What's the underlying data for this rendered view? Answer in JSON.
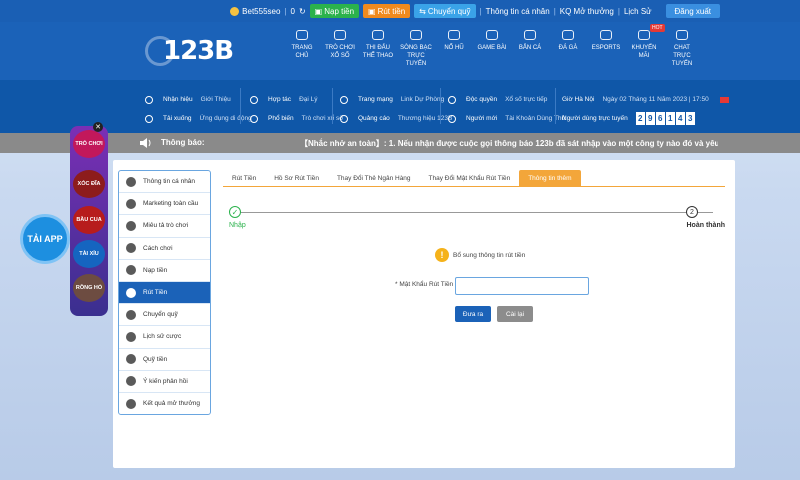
{
  "topbar": {
    "username": "Bet555seo",
    "balance": "0",
    "deposit_label": "Nạp tiền",
    "withdraw_label": "Rút tiền",
    "transfer_label": "Chuyển quỹ",
    "links": [
      "Thông tin cá nhân",
      "KQ Mở thưởng",
      "Lịch Sử"
    ],
    "logout_label": "Đăng xuất"
  },
  "nav": {
    "logo": "123B",
    "menu": [
      {
        "label": "TRANG CHỦ",
        "icon": "home-icon"
      },
      {
        "label": "TRÒ CHƠI XỔ SỐ",
        "icon": "lottery-icon"
      },
      {
        "label": "THI ĐẤU THỂ THAO",
        "icon": "sports-icon"
      },
      {
        "label": "SÒNG BẠC TRỰC TUYẾN",
        "icon": "casino-icon"
      },
      {
        "label": "NỔ HŨ",
        "icon": "slot-icon"
      },
      {
        "label": "GAME BÀI",
        "icon": "cards-icon"
      },
      {
        "label": "BẮN CÁ",
        "icon": "fish-icon"
      },
      {
        "label": "ĐÁ GÀ",
        "icon": "rooster-icon"
      },
      {
        "label": "ESPORTS",
        "icon": "esports-icon"
      },
      {
        "label": "KHUYẾN MÃI",
        "icon": "gift-icon",
        "badge": "HOT"
      },
      {
        "label": "CHAT TRỰC TUYẾN",
        "icon": "chat-icon"
      }
    ]
  },
  "subnav": {
    "col1": [
      [
        "Nhận hiệu",
        "Giới Thiệu"
      ],
      [
        "Tải xuống",
        "Ứng dụng di động"
      ]
    ],
    "col2": [
      [
        "Hợp tác",
        "Đại Lý"
      ],
      [
        "Phổ biến",
        "Trò chơi xổ số"
      ]
    ],
    "col3": [
      [
        "Trang mạng",
        "Link Dự Phòng"
      ],
      [
        "Quảng cáo",
        "Thương hiệu 123B"
      ]
    ],
    "col4": [
      [
        "Độc quyền",
        "Xổ số trực tiếp"
      ],
      [
        "Người mới",
        "Tài Khoản Dùng Thử"
      ]
    ],
    "time_label": "Giờ Hà Nội",
    "time_value": "Ngày 02 Tháng 11 Năm 2023 | 17:50",
    "online_label": "Người dùng trực tuyến",
    "online_digits": [
      "2",
      "9",
      "6",
      "1",
      "4",
      "3"
    ]
  },
  "ticker": {
    "label": "Thông báo:",
    "message": "【Nhắc nhở an toàn】: 1. Nếu nhận được cuộc gọi thông báo 123b đã sát nhập vào một công ty nào đó và yêu cầu khá"
  },
  "floating": {
    "games": [
      "TRÒ CHƠI",
      "XÓC ĐĨA",
      "BẦU CUA",
      "TÀI XỈU",
      "RỒNG HỔ"
    ],
    "app_label": "TẢI APP"
  },
  "sidebar": {
    "items": [
      {
        "label": "Thông tin cá nhân",
        "icon": "user-card-icon"
      },
      {
        "label": "Marketing toàn cầu",
        "icon": "diamond-icon"
      },
      {
        "label": "Miêu tả trò chơi",
        "icon": "gamepad-icon"
      },
      {
        "label": "Cách chơi",
        "icon": "info-icon"
      },
      {
        "label": "Nạp tiền",
        "icon": "piggy-bank-icon"
      },
      {
        "label": "Rút Tiền",
        "icon": "bank-icon",
        "active": true
      },
      {
        "label": "Chuyển quỹ",
        "icon": "coin-icon"
      },
      {
        "label": "Lịch sử cược",
        "icon": "history-icon"
      },
      {
        "label": "Quỹ tiền",
        "icon": "wallet-icon"
      },
      {
        "label": "Ý kiến phản hồi",
        "icon": "feedback-icon"
      },
      {
        "label": "Kết quả mở thưởng",
        "icon": "results-icon"
      }
    ]
  },
  "tabs": [
    {
      "label": "Rút Tiền"
    },
    {
      "label": "Hồ Sơ Rút Tiền"
    },
    {
      "label": "Thay Đổi Thẻ Ngân Hàng"
    },
    {
      "label": "Thay Đổi Mật Khẩu Rút Tiền"
    },
    {
      "label": "Thông tin thêm",
      "active": true
    }
  ],
  "stepper": {
    "start_label": "Nhập",
    "end_number": "2",
    "end_label": "Hoàn thành"
  },
  "form": {
    "notice": "Bổ sung thông tin rút tiền",
    "password_label": "* Mật Khẩu Rút Tiền",
    "password_value": "",
    "submit_label": "Đưa ra",
    "reset_label": "Cài lại"
  },
  "colors": {
    "primary": "#1b62b8",
    "accent": "#f3a63a",
    "success": "#2bb24c"
  }
}
